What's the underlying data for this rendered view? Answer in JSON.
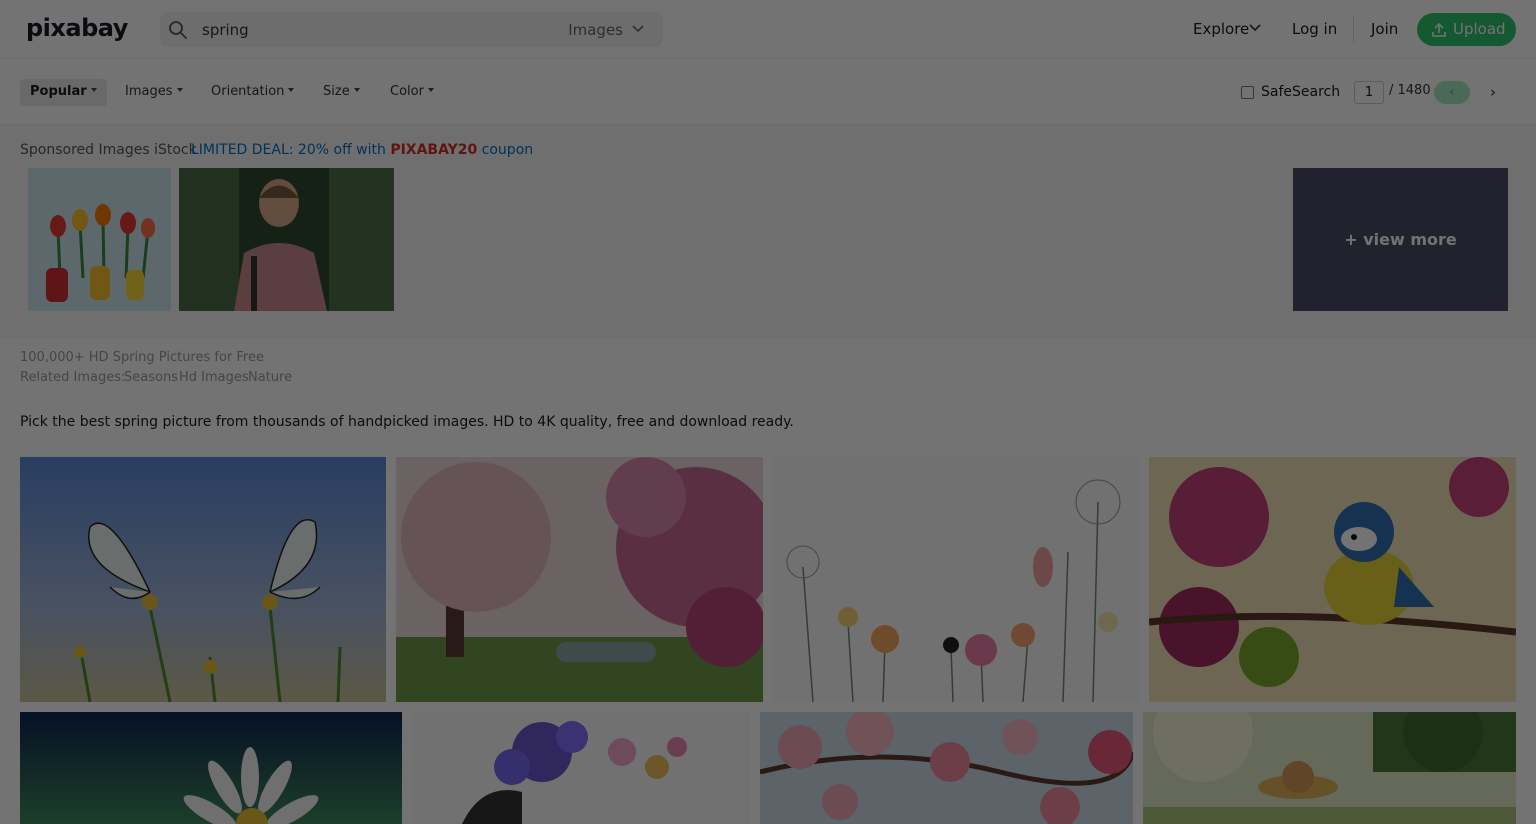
{
  "header": {
    "logo": "pixabay",
    "search": {
      "query": "spring",
      "type": "Images"
    },
    "nav": {
      "explore": "Explore",
      "login": "Log in",
      "join": "Join",
      "upload": "Upload"
    }
  },
  "filters": {
    "items": [
      "Popular",
      "Images",
      "Orientation",
      "Size",
      "Color"
    ],
    "active": "Popular",
    "safesearch": "SafeSearch",
    "page_current": "1",
    "page_total": "/ 1480",
    "prev_symbol": "‹",
    "next_symbol": "›"
  },
  "sponsored": {
    "label": "Sponsored Images iStock",
    "deal_prefix": "LIMITED DEAL: 20% off with",
    "deal_code": "PIXABAY20",
    "deal_suffix": "coupon",
    "view_more": "+ view more"
  },
  "content": {
    "title": "100,000+ HD Spring Pictures for Free",
    "related_label": "Related Images:",
    "related": [
      "Seasons",
      "Hd Images",
      "Nature"
    ],
    "description": "Pick the best spring picture from thousands of handpicked images. HD to 4K quality, free and download ready."
  },
  "gallery": [
    {
      "subject": "butterflies on dandelions"
    },
    {
      "subject": "magnolia tree blossoms"
    },
    {
      "subject": "watercolor wildflowers"
    },
    {
      "subject": "blue tit on blossom branch"
    },
    {
      "subject": "white daisy"
    },
    {
      "subject": "woman with flower bouquet head illustration"
    },
    {
      "subject": "cherry blossoms"
    },
    {
      "subject": "woman with straw hat in meadow"
    }
  ],
  "colors": {
    "brand_green": "#2ec66d",
    "link_blue": "#0070c9",
    "coupon_red": "#d62b2b",
    "view_more_bg": "#4a4c66"
  }
}
